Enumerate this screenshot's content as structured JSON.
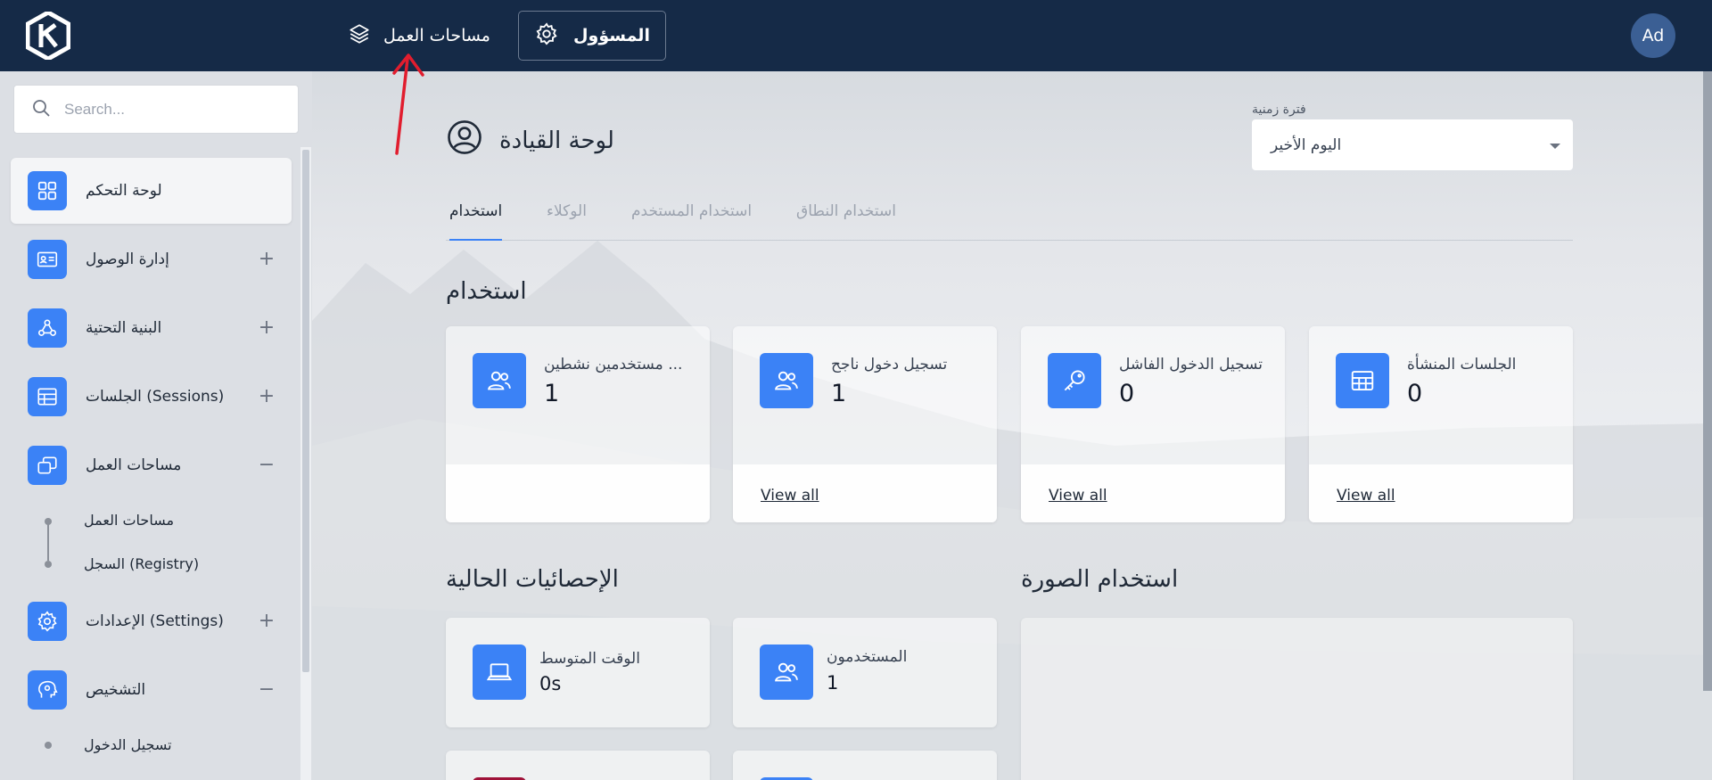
{
  "topbar": {
    "workspaces_label": "مساحات العمل",
    "admin_label": "المسؤول",
    "avatar_initials": "Ad"
  },
  "sidebar": {
    "search_placeholder": "Search...",
    "items": [
      {
        "label": "لوحة التحكم",
        "icon": "grid-icon",
        "active": true
      },
      {
        "label": "إدارة الوصول",
        "icon": "id-card-icon",
        "toggle": "+"
      },
      {
        "label": "البنية التحتية",
        "icon": "webhook-icon",
        "toggle": "+"
      },
      {
        "label": "الجلسات (Sessions)",
        "icon": "table-icon",
        "toggle": "+"
      },
      {
        "label": "مساحات العمل",
        "icon": "windows-icon",
        "toggle": "−"
      },
      {
        "label": "الإعدادات (Settings)",
        "icon": "gear-icon",
        "toggle": "+"
      },
      {
        "label": "التشخيص",
        "icon": "head-icon",
        "toggle": "−"
      }
    ],
    "workspaces_sub": [
      "مساحات العمل",
      "السجل (Registry)"
    ],
    "diagnostics_sub": [
      "تسجيل الدخول"
    ]
  },
  "main": {
    "title": "لوحة القيادة",
    "period_label": "فترة زمنية",
    "period_value": "اليوم الأخير",
    "tabs": [
      "استخدام",
      "الوكلاء",
      "استخدام المستخدم",
      "استخدام النطاق"
    ],
    "usage_title": "استخدام",
    "cards": [
      {
        "label": "الجلسات المنشأة",
        "value": "0",
        "link": "View all",
        "icon": "table-icon"
      },
      {
        "label": "تسجيل الدخول الفاشل",
        "value": "0",
        "link": "View all",
        "icon": "key-icon"
      },
      {
        "label": "تسجيل دخول ناجح",
        "value": "1",
        "link": "View all",
        "icon": "users-icon"
      },
      {
        "label": "مستخدمين نشطين ...",
        "value": "1",
        "icon": "users-icon"
      }
    ],
    "image_usage_title": "استخدام الصورة",
    "current_stats_title": "الإحصائيات الحالية",
    "stats": [
      {
        "label": "المستخدمون",
        "value": "1",
        "icon": "users-icon"
      },
      {
        "label": "الوقت المتوسط",
        "value": "0s",
        "icon": "laptop-icon"
      }
    ]
  },
  "colors": {
    "topbar": "#152a47",
    "accent": "#3b82f6",
    "annotation": "#e11d2e"
  }
}
